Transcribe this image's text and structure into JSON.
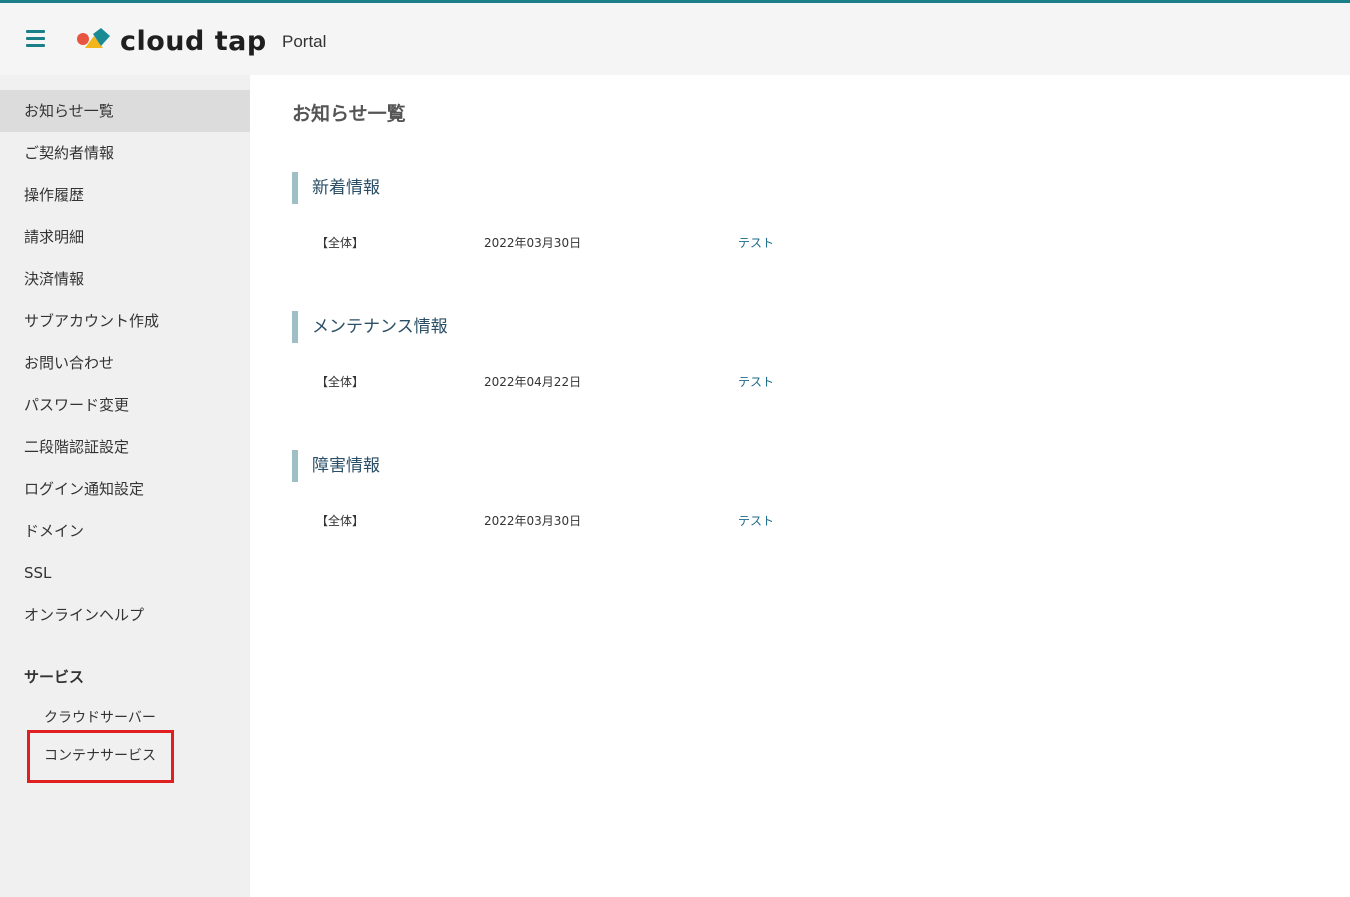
{
  "header": {
    "brand": "cloud tap",
    "portal_label": "Portal"
  },
  "sidebar": {
    "items": [
      {
        "label": "お知らせ一覧",
        "active": true
      },
      {
        "label": "ご契約者情報"
      },
      {
        "label": "操作履歴"
      },
      {
        "label": "請求明細"
      },
      {
        "label": "決済情報"
      },
      {
        "label": "サブアカウント作成"
      },
      {
        "label": "お問い合わせ"
      },
      {
        "label": "パスワード変更"
      },
      {
        "label": "二段階認証設定"
      },
      {
        "label": "ログイン通知設定"
      },
      {
        "label": "ドメイン"
      },
      {
        "label": "SSL"
      },
      {
        "label": "オンラインヘルプ"
      }
    ],
    "services_title": "サービス",
    "services": [
      {
        "label": "クラウドサーバー"
      },
      {
        "label": "コンテナサービス",
        "highlighted": true
      }
    ]
  },
  "main": {
    "title": "お知らせ一覧",
    "sections": [
      {
        "title": "新着情報",
        "rows": [
          {
            "category": "【全体】",
            "date": "2022年03月30日",
            "subject": "テスト"
          }
        ]
      },
      {
        "title": "メンテナンス情報",
        "rows": [
          {
            "category": "【全体】",
            "date": "2022年04月22日",
            "subject": "テスト"
          }
        ]
      },
      {
        "title": "障害情報",
        "rows": [
          {
            "category": "【全体】",
            "date": "2022年03月30日",
            "subject": "テスト"
          }
        ]
      }
    ]
  },
  "colors": {
    "accent": "#1a7f86",
    "highlight": "#e02020",
    "section_bar": "#9fbfc7",
    "link": "#1a6a8a"
  }
}
